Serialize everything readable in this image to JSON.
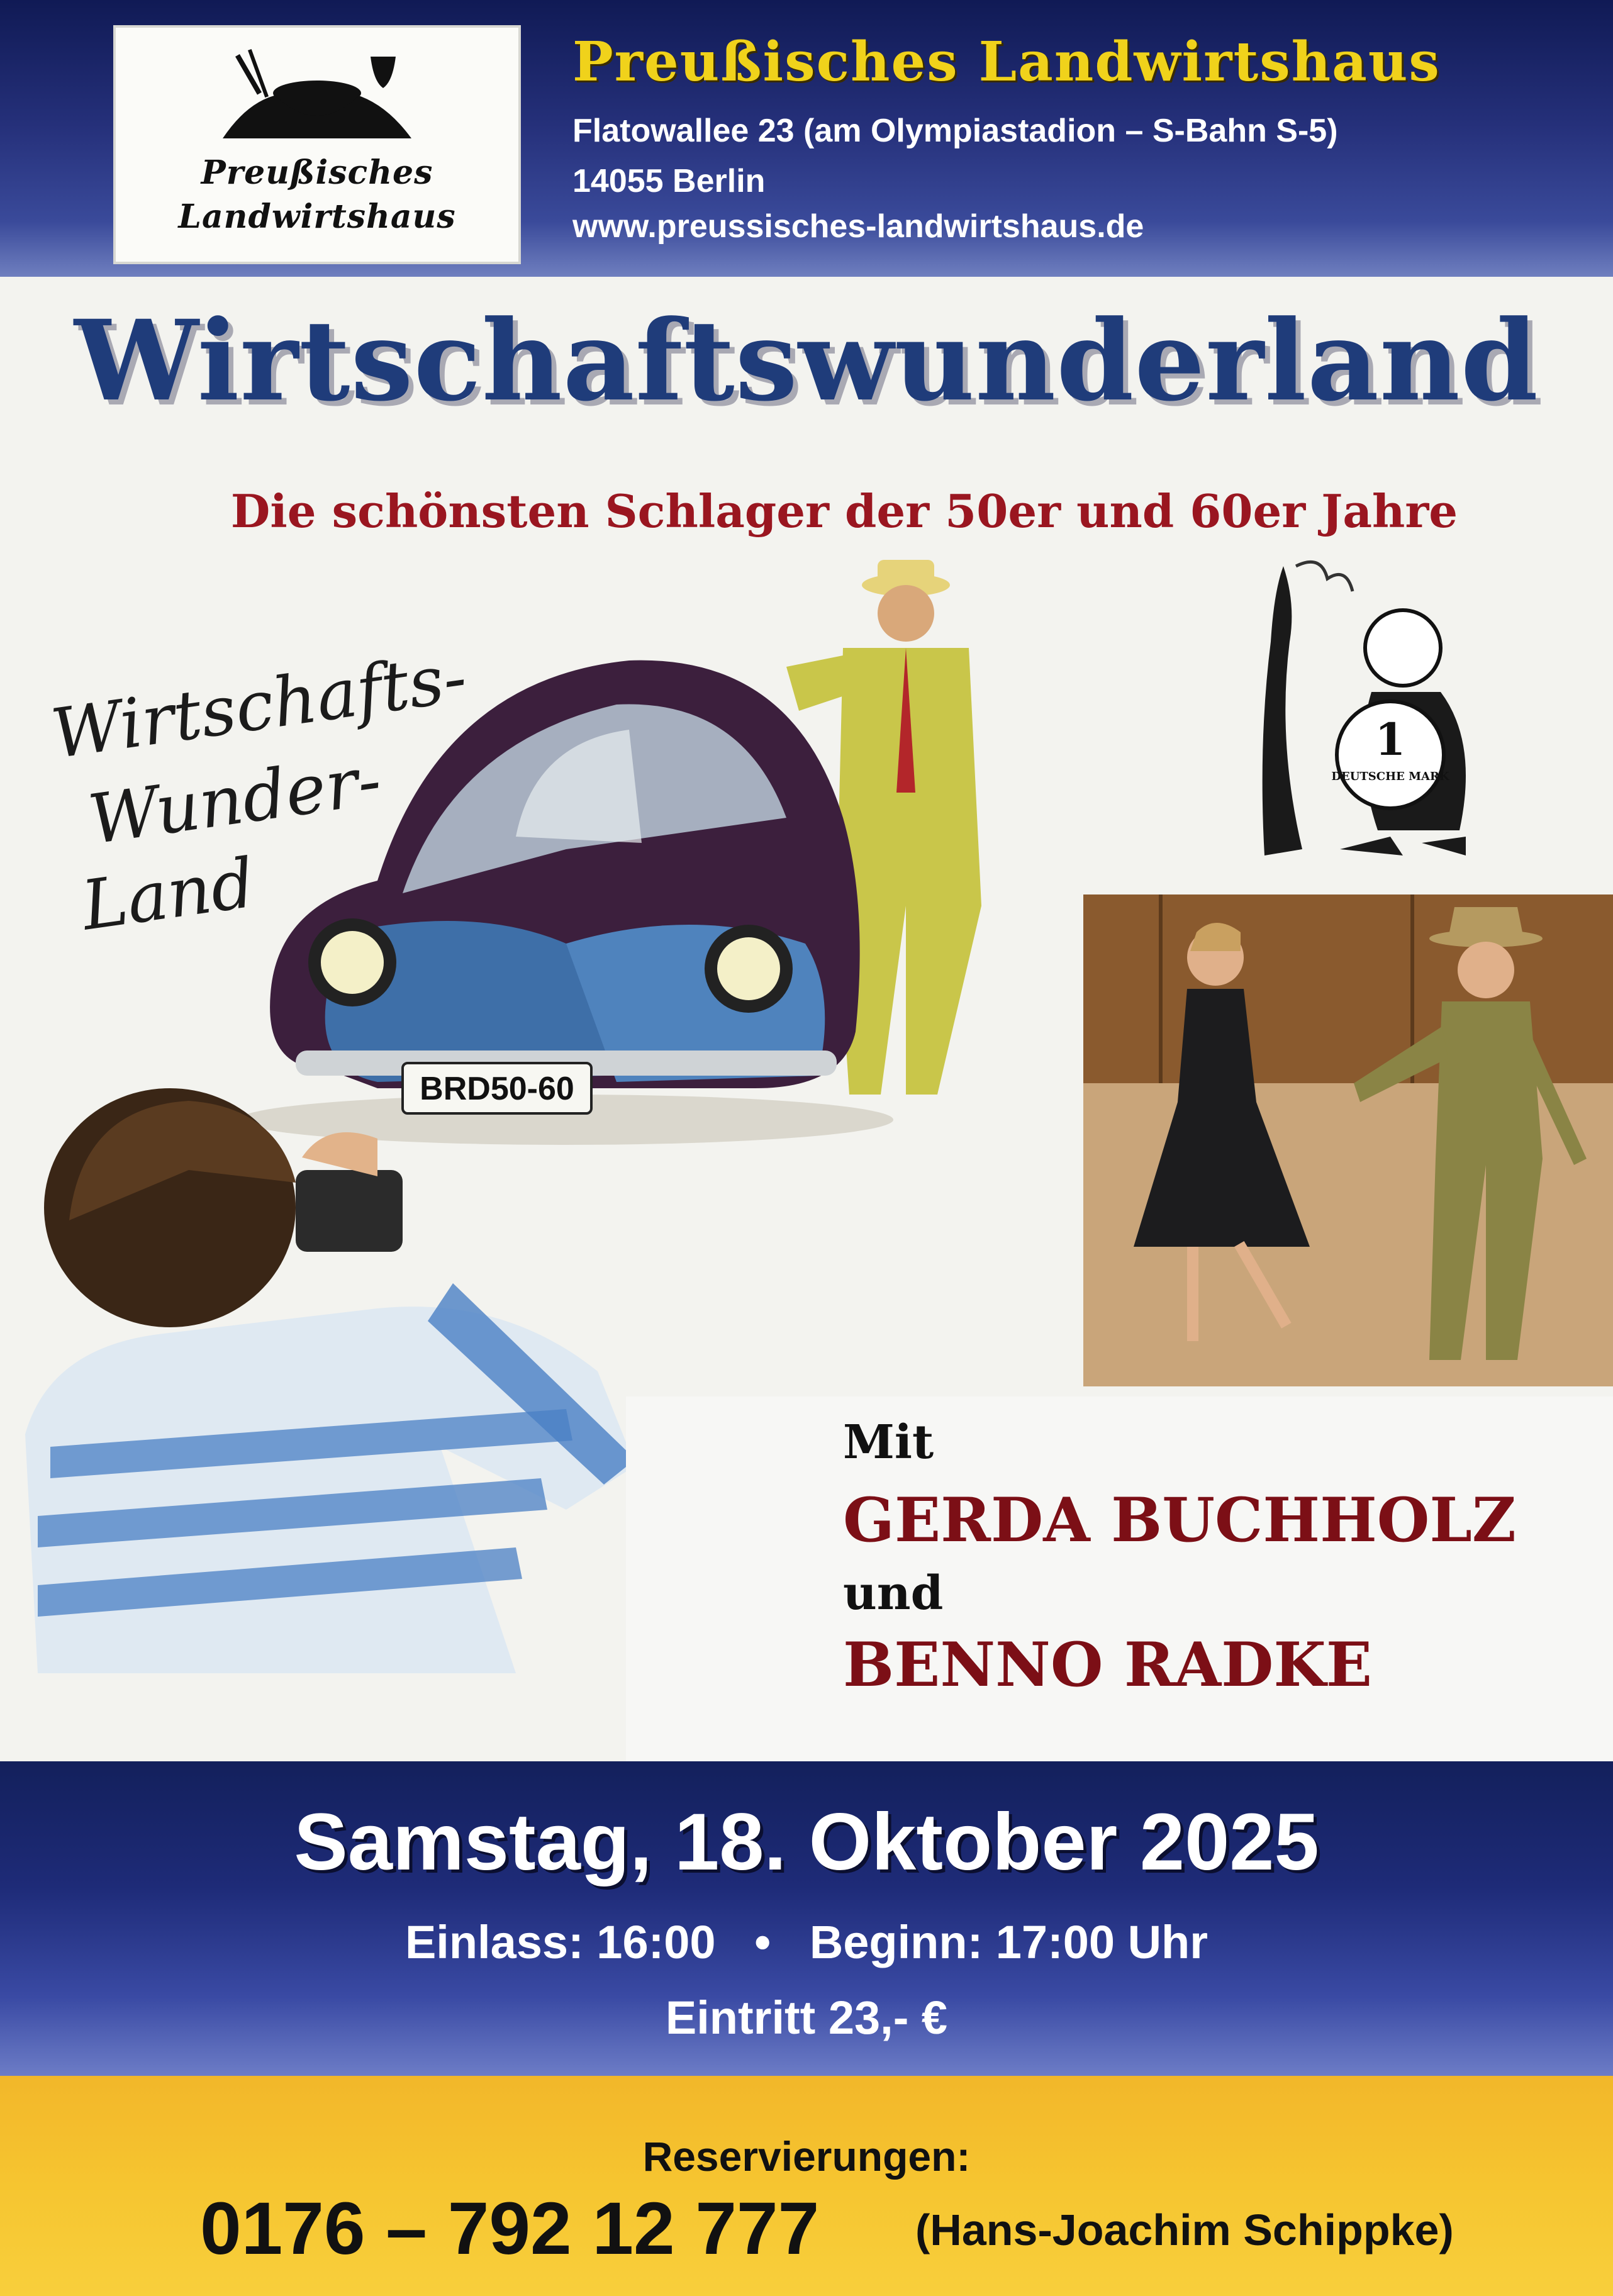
{
  "header": {
    "logo_line1": "Preußisches",
    "logo_line2": "Landwirtshaus",
    "title": "Preußisches Landwirtshaus",
    "address": "Flatowallee 23 (am Olympiastadion – S-Bahn S-5)",
    "city": "14055 Berlin",
    "url": "www.preussisches-landwirtshaus.de"
  },
  "main": {
    "title": "Wirtschaftswunderland",
    "subtitle": "Die schönsten Schlager der 50er und 60er Jahre",
    "handwriting": [
      "Wirtschafts-",
      "Wunder-",
      "Land"
    ],
    "license_plate": "BRD50-60",
    "coin_text_1": "1",
    "coin_text_2": "DEUTSCHE MARK"
  },
  "performers": {
    "intro": "Mit",
    "name1": "GERDA BUCHHOLZ",
    "conjunction": "und",
    "name2": "BENNO RADKE"
  },
  "event": {
    "date": "Samstag, 18. Oktober 2025",
    "times": "Einlass: 16:00   •   Beginn: 17:00 Uhr",
    "entry": "Eintritt 23,- €"
  },
  "reservation": {
    "label": "Reservierungen:",
    "phone": "0176 – 792 12 777",
    "contact": "(Hans-Joachim Schippke)"
  },
  "colors": {
    "header_blue": "#25307a",
    "title_blue": "#1f3c7a",
    "accent_red": "#9a1620",
    "gold": "#f0d21b",
    "reservation_yellow": "#f6c530"
  }
}
